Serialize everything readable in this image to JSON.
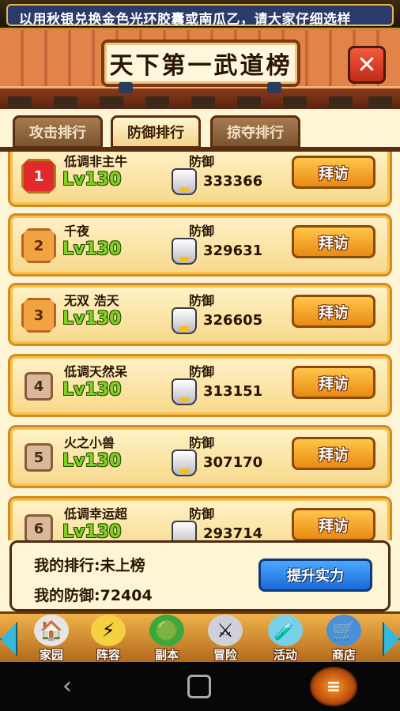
{
  "marquee": {
    "text": "以用秋银兑换金色光环胶囊或南瓜乙，请大家仔细选样"
  },
  "header": {
    "title": "天下第一武道榜",
    "close_icon": "close-x-icon"
  },
  "tabs": [
    {
      "label": "攻击排行",
      "active": false
    },
    {
      "label": "防御排行",
      "active": true
    },
    {
      "label": "掠夺排行",
      "active": false
    }
  ],
  "rankings": [
    {
      "rank": "1",
      "name": "低调非主牛",
      "level": "Lv130",
      "stat_label": "防御",
      "value": "333366",
      "button": "拜访"
    },
    {
      "rank": "2",
      "name": "千夜",
      "level": "Lv130",
      "stat_label": "防御",
      "value": "329631",
      "button": "拜访"
    },
    {
      "rank": "3",
      "name": "无双 浩天",
      "level": "Lv130",
      "stat_label": "防御",
      "value": "326605",
      "button": "拜访"
    },
    {
      "rank": "4",
      "name": "低调天然呆",
      "level": "Lv130",
      "stat_label": "防御",
      "value": "313151",
      "button": "拜访"
    },
    {
      "rank": "5",
      "name": "火之小兽",
      "level": "Lv130",
      "stat_label": "防御",
      "value": "307170",
      "button": "拜访"
    },
    {
      "rank": "6",
      "name": "低调幸运超",
      "level": "Lv130",
      "stat_label": "防御",
      "value": "293714",
      "button": "拜访"
    }
  ],
  "my_info": {
    "rank_text": "我的排行:未上榜",
    "defense_text": "我的防御:72404",
    "boost_button": "提升实力"
  },
  "nav": [
    {
      "label": "家园",
      "icon": "home-icon"
    },
    {
      "label": "阵容",
      "icon": "lineup-icon"
    },
    {
      "label": "副本",
      "icon": "dungeon-icon"
    },
    {
      "label": "冒险",
      "icon": "adventure-icon"
    },
    {
      "label": "活动",
      "icon": "event-icon"
    },
    {
      "label": "商店",
      "icon": "shop-icon"
    }
  ]
}
